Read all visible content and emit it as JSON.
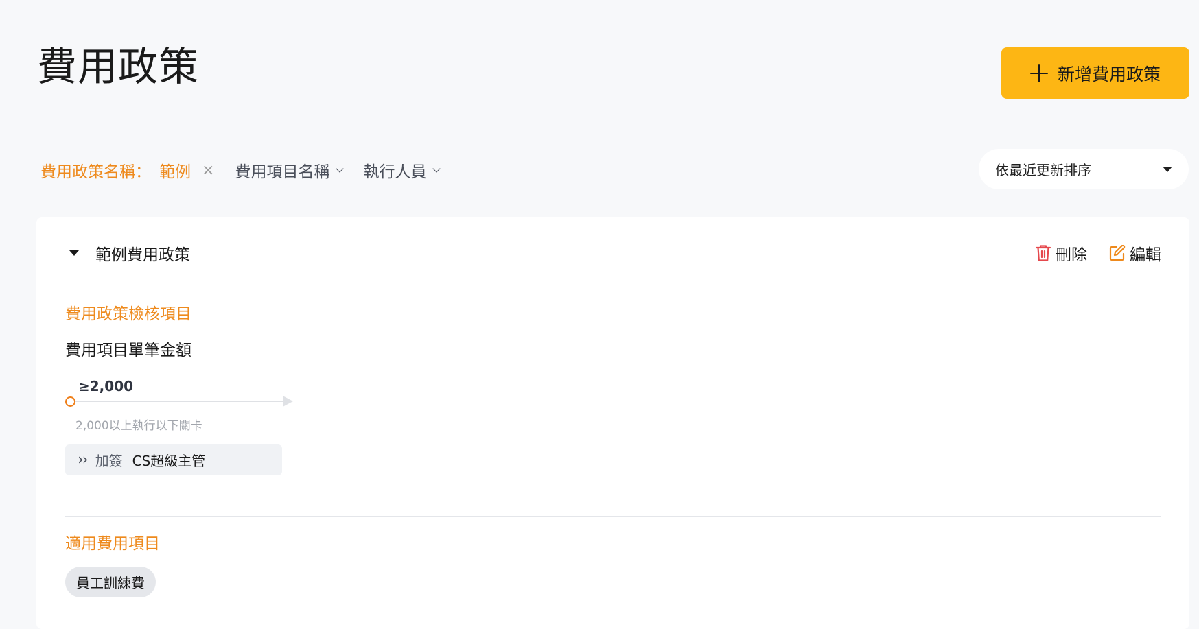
{
  "page": {
    "title": "費用政策",
    "add_button_label": "新增費用政策"
  },
  "filters": {
    "active_label": "費用政策名稱：",
    "active_value": "範例",
    "clear_symbol": "×",
    "dropdowns": [
      {
        "label": "費用項目名稱"
      },
      {
        "label": "執行人員"
      }
    ]
  },
  "sort": {
    "selected": "依最近更新排序"
  },
  "policy": {
    "name": "範例費用政策",
    "delete_label": "刪除",
    "edit_label": "編輯",
    "check_section_title": "費用政策檢核項目",
    "check_item_title": "費用項目單筆金額",
    "threshold_label": "≥2,000",
    "threshold_desc": "2,000以上執行以下關卡",
    "approver": {
      "type": "加簽",
      "name": "CS超級主管"
    },
    "applicable_section_title": "適用費用項目",
    "applicable_items": [
      "員工訓練費"
    ]
  },
  "colors": {
    "accent_orange": "#ee8a1d",
    "primary_button": "#fdb614",
    "delete_icon": "#e5484d"
  }
}
